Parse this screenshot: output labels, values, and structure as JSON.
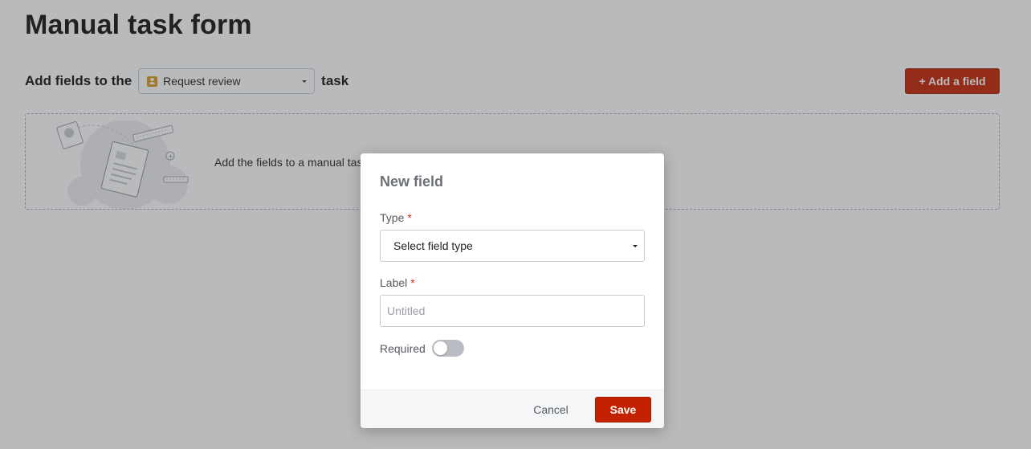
{
  "page": {
    "title": "Manual task form",
    "add_fields_prefix": "Add fields to the",
    "add_fields_suffix": "task",
    "task_select_value": "Request review",
    "add_field_button": "+ Add a field",
    "empty_state_text": "Add the fields to a manual task to create a form"
  },
  "modal": {
    "title": "New field",
    "type_label": "Type",
    "type_required_mark": "*",
    "type_select_value": "Select field type",
    "label_label": "Label",
    "label_required_mark": "*",
    "label_placeholder": "Untitled",
    "required_label": "Required",
    "required_toggle_on": false,
    "cancel_button": "Cancel",
    "save_button": "Save"
  },
  "colors": {
    "accent": "#c42100",
    "task_icon": "#d99a1c",
    "required_star": "#d4281c"
  },
  "icons": {
    "task_icon": "person-badge-icon",
    "empty_illustration": "form-documents-illustration"
  }
}
